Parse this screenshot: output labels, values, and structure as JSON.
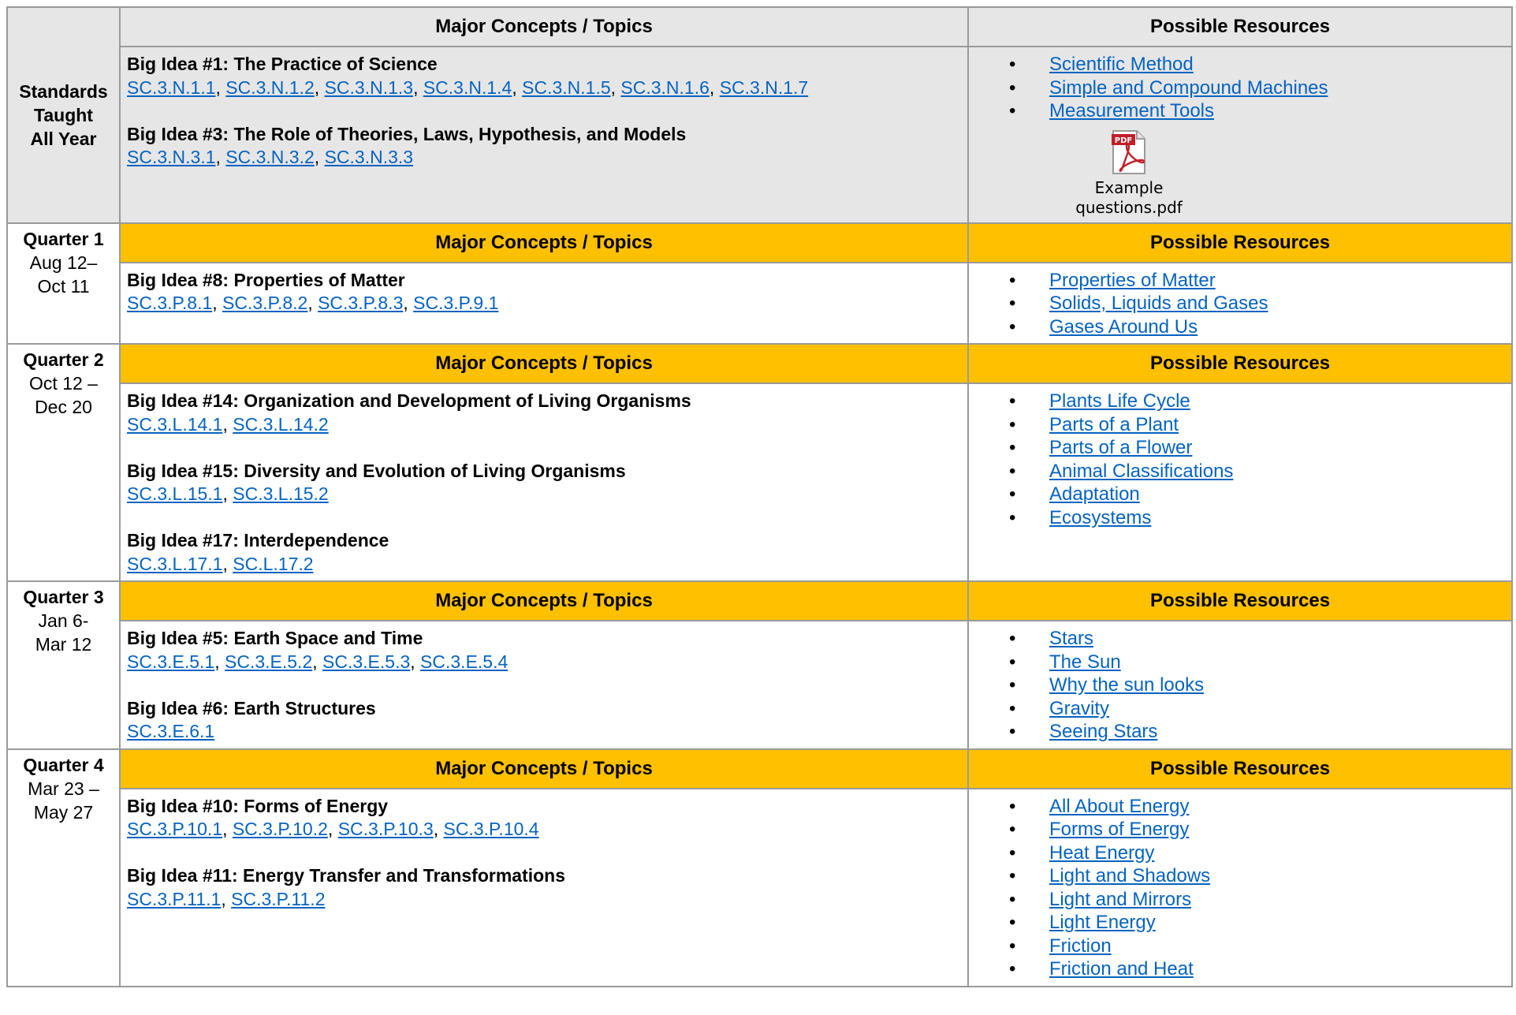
{
  "headers": {
    "topics": "Major Concepts / Topics",
    "resources": "Possible Resources"
  },
  "colors": {
    "header_gold": "#ffc000",
    "header_gray": "#e6e6e6",
    "link_blue": "#0563c1",
    "border": "#9a9a9a"
  },
  "all_year": {
    "label_line1": "Standards",
    "label_line2": "Taught",
    "label_line3": "All Year",
    "ideas": [
      {
        "title": "Big Idea #1: The Practice of Science",
        "standards": [
          "SC.3.N.1.1",
          "SC.3.N.1.2",
          "SC.3.N.1.3",
          "SC.3.N.1.4",
          "SC.3.N.1.5",
          "SC.3.N.1.6",
          "SC.3.N.1.7"
        ]
      },
      {
        "title": "Big Idea #3: The Role of Theories, Laws, Hypothesis, and Models",
        "standards": [
          "SC.3.N.3.1",
          "SC.3.N.3.2",
          "SC.3.N.3.3"
        ]
      }
    ],
    "resources": [
      "Scientific Method",
      "Simple and Compound Machines",
      "Measurement Tools"
    ],
    "attachment": {
      "icon": "pdf-file-icon",
      "icon_text": "PDF",
      "name_line1": "Example",
      "name_line2": "questions.pdf"
    }
  },
  "quarters": [
    {
      "title": "Quarter 1",
      "dates_line1": "Aug 12–",
      "dates_line2": "Oct 11",
      "ideas": [
        {
          "title": "Big Idea #8: Properties of Matter",
          "standards": [
            "SC.3.P.8.1",
            "SC.3.P.8.2",
            "SC.3.P.8.3",
            "SC.3.P.9.1"
          ]
        }
      ],
      "resources": [
        "Properties of Matter",
        "Solids, Liquids and Gases",
        "Gases Around Us"
      ]
    },
    {
      "title": "Quarter 2",
      "dates_line1": "Oct 12 –",
      "dates_line2": "Dec 20",
      "ideas": [
        {
          "title": "Big Idea #14: Organization and Development of Living Organisms",
          "standards": [
            "SC.3.L.14.1",
            "SC.3.L.14.2"
          ]
        },
        {
          "title": "Big Idea #15: Diversity and Evolution of Living Organisms",
          "standards": [
            "SC.3.L.15.1",
            "SC.3.L.15.2"
          ]
        },
        {
          "title": "Big Idea #17: Interdependence",
          "standards": [
            "SC.3.L.17.1",
            "SC.L.17.2"
          ]
        }
      ],
      "resources": [
        "Plants Life Cycle",
        "Parts of a Plant",
        "Parts of a Flower",
        "Animal Classifications",
        "Adaptation",
        "Ecosystems"
      ]
    },
    {
      "title": "Quarter 3",
      "dates_line1": "Jan 6-",
      "dates_line2": "Mar 12",
      "ideas": [
        {
          "title": "Big Idea #5: Earth Space and Time",
          "standards": [
            "SC.3.E.5.1",
            "SC.3.E.5.2",
            "SC.3.E.5.3",
            "SC.3.E.5.4"
          ]
        },
        {
          "title": "Big Idea #6: Earth Structures",
          "standards": [
            "SC.3.E.6.1"
          ]
        }
      ],
      "resources": [
        "Stars",
        "The Sun",
        "Why the sun looks",
        "Gravity",
        "Seeing Stars"
      ]
    },
    {
      "title": "Quarter 4",
      "dates_line1": "Mar 23 –",
      "dates_line2": "May 27",
      "ideas": [
        {
          "title": "Big Idea #10: Forms of Energy",
          "standards": [
            "SC.3.P.10.1",
            "SC.3.P.10.2",
            "SC.3.P.10.3",
            "SC.3.P.10.4"
          ]
        },
        {
          "title": "Big Idea #11: Energy Transfer and Transformations",
          "standards": [
            "SC.3.P.11.1",
            "SC.3.P.11.2"
          ]
        }
      ],
      "resources": [
        "All About Energy",
        "Forms of Energy",
        "Heat Energy",
        "Light and Shadows",
        "Light and Mirrors",
        "Light Energy",
        "Friction",
        "Friction and Heat"
      ]
    }
  ]
}
